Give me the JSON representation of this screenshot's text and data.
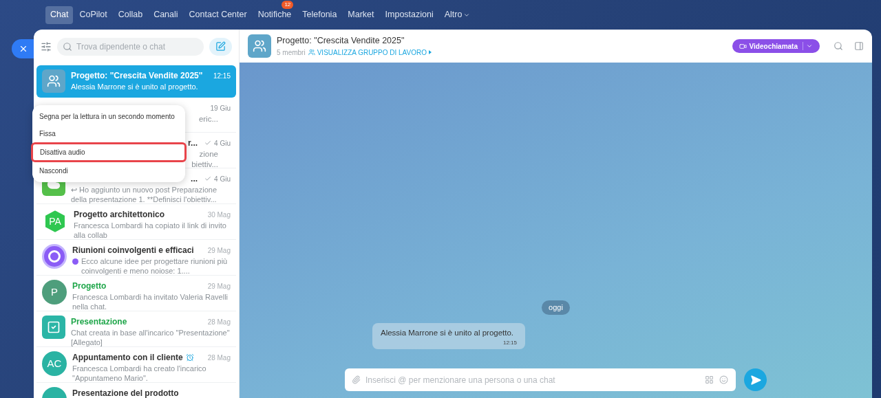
{
  "nav": [
    {
      "label": "Chat",
      "selected": true
    },
    {
      "label": "CoPilot",
      "selected": false
    },
    {
      "label": "Collab",
      "selected": false
    },
    {
      "label": "Canali",
      "selected": false
    },
    {
      "label": "Contact Center",
      "selected": false
    },
    {
      "label": "Notifiche",
      "selected": false,
      "badge": "12"
    },
    {
      "label": "Telefonia",
      "selected": false
    },
    {
      "label": "Market",
      "selected": false
    },
    {
      "label": "Impostazioni",
      "selected": false
    },
    {
      "label": "Altro",
      "selected": false,
      "caret": true
    }
  ],
  "sidebar": {
    "search": {
      "placeholder": "Trova dipendente o chat"
    },
    "chats": [
      {
        "kind": "full",
        "title": "Progetto: \"Crescita Vendite 2025\"",
        "time": "12:15",
        "preview": "Alessia Marrone si è unito al progetto.",
        "selected": true,
        "green_title": false,
        "avatar": {
          "kind": "group",
          "color": "#5fa6c9"
        }
      },
      {
        "kind": "covered",
        "time": "19 Giu",
        "fragments": [
          "eric..."
        ],
        "read": false,
        "selected": false
      },
      {
        "kind": "covered",
        "title": "r...",
        "time": "4 Giu",
        "fragments": [
          "zione",
          "biettiv..."
        ],
        "read": true,
        "selected": false
      },
      {
        "kind": "covered",
        "title": "...",
        "time": "4 Giu",
        "preview": "↩ Ho aggiunto un nuovo post Preparazione della presentazione 1. **Definisci l'obiettiv...",
        "read": true,
        "selected": false,
        "avatar": {
          "kind": "cloud",
          "color": "#55c04a"
        }
      },
      {
        "kind": "full",
        "title": "Progetto architettonico",
        "time": "30 Mag",
        "preview": "Francesca Lombardi ha copiato il link di invito alla collab",
        "selected": false,
        "green_title": false,
        "avatar": {
          "kind": "hexagon",
          "text": "PA",
          "color": "#2fc750"
        }
      },
      {
        "kind": "full",
        "title": "Riunioni coinvolgenti e efficaci",
        "time": "29 Mag",
        "preview": "Ecco alcune idee per progettare riunioni più coinvolgenti e meno noiose: 1....",
        "preview_icon": true,
        "selected": false,
        "green_title": false,
        "avatar": {
          "kind": "copilot",
          "color": "#8b5cf6"
        }
      },
      {
        "kind": "full",
        "title": "Progetto",
        "time": "29 Mag",
        "preview": "Francesca Lombardi ha invitato Valeria Ravelli nella chat.",
        "selected": false,
        "green_title": true,
        "avatar": {
          "kind": "letter",
          "text": "P",
          "color": "#4e9e7c"
        }
      },
      {
        "kind": "full",
        "title": "Presentazione",
        "time": "28 Mag",
        "preview": "Chat creata in base all'incarico \"Presentazione\" [Allegato]",
        "selected": false,
        "green_title": true,
        "avatar": {
          "kind": "task",
          "color": "#2bb5a6"
        }
      },
      {
        "kind": "full",
        "title": "Appuntamento con il cliente",
        "time": "28 Mag",
        "preview": "Francesca Lombardi ha creato l'incarico \"Appuntameno Mario\".",
        "title_icon": true,
        "selected": false,
        "green_title": false,
        "avatar": {
          "kind": "letter",
          "text": "AC",
          "color": "#2ab3a3"
        }
      },
      {
        "kind": "full",
        "title": "Presentazione del prodotto",
        "selected": false,
        "green_title": false,
        "avatar": {
          "kind": "letter",
          "color": "#2ab3a3"
        }
      }
    ]
  },
  "context_menu": [
    {
      "label": "Segna per la lettura in un secondo momento",
      "highlighted": false
    },
    {
      "label": "Fissa",
      "highlighted": false
    },
    {
      "label": "Disattiva audio",
      "highlighted": true
    },
    {
      "label": "Nascondi",
      "highlighted": false
    }
  ],
  "header": {
    "title": "Progetto: \"Crescita Vendite 2025\"",
    "members": "5 membri",
    "link": "VISUALIZZA GRUPPO DI LAVORO",
    "call_button": "Videochiamata"
  },
  "chat": {
    "date": "oggi",
    "messages": [
      {
        "text": "Alessia Marrone si è unito al progetto.",
        "time": "12:15"
      }
    ],
    "input": {
      "placeholder": "Inserisci @ per menzionare una persona o una chat"
    }
  }
}
